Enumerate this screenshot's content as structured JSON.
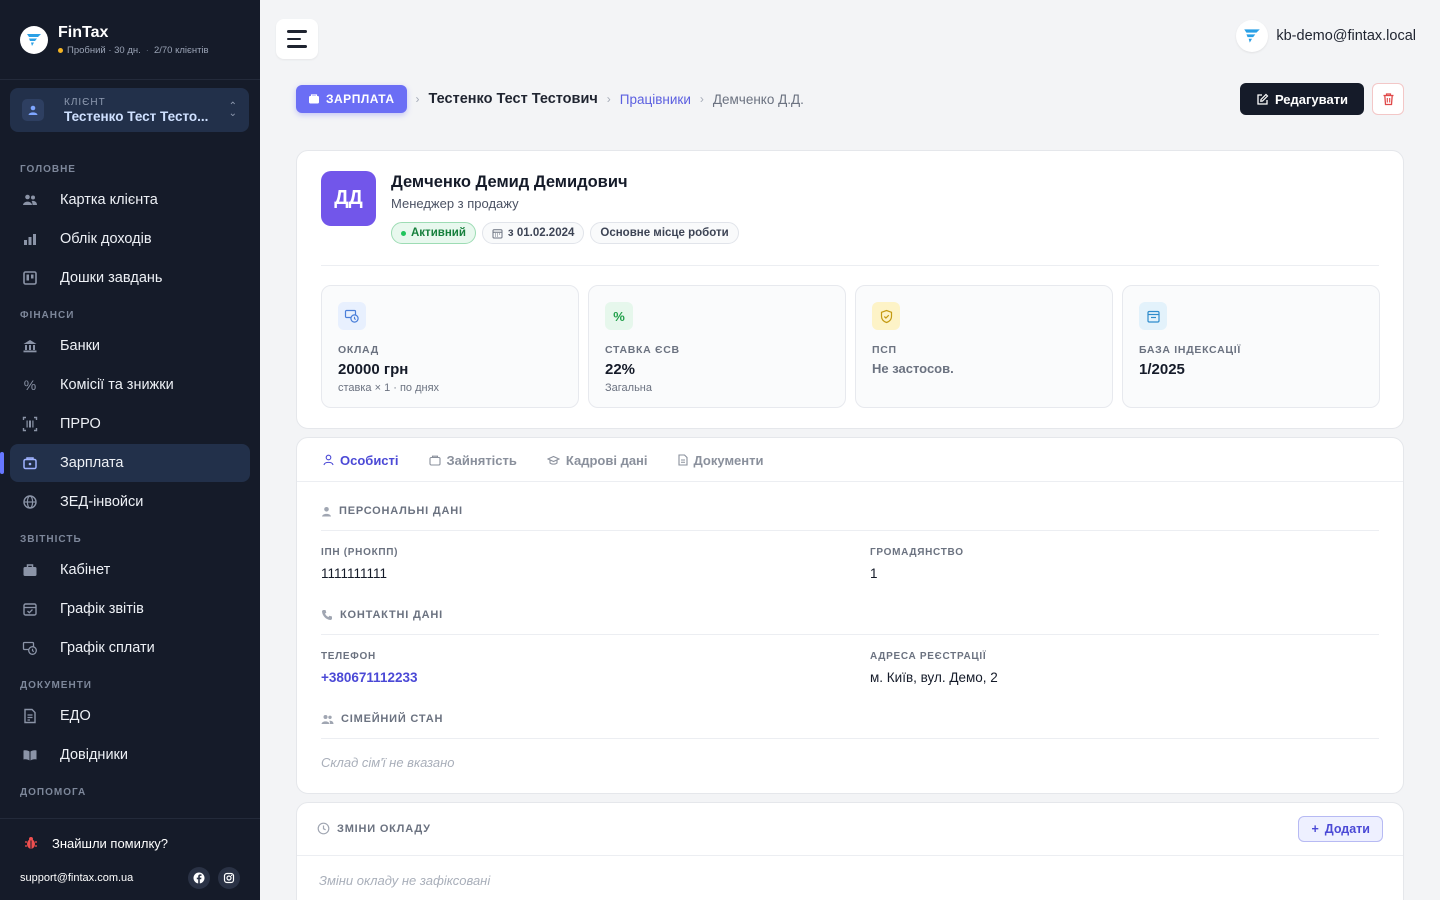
{
  "brand": {
    "name": "FinTax",
    "trial": "Пробний · 30 дн.",
    "clients": "2/70 клієнтів"
  },
  "client": {
    "label": "КЛІЄНТ",
    "name": "Тестенко Тест Тесто..."
  },
  "nav": {
    "sections": {
      "main": "ГОЛОВНЕ",
      "finance": "ФІНАНСИ",
      "reports": "ЗВІТНІСТЬ",
      "docs": "ДОКУМЕНТИ",
      "help": "ДОПОМОГА"
    },
    "items": {
      "client_card": "Картка клієнта",
      "income": "Облік доходів",
      "tasks": "Дошки завдань",
      "banks": "Банки",
      "commissions": "Комісії та знижки",
      "prro": "ПРРО",
      "salary": "Зарплата",
      "zed": "ЗЕД-інвойси",
      "cabinet": "Кабінет",
      "report_schedule": "Графік звітів",
      "payment_schedule": "Графік сплати",
      "edo": "ЕДО",
      "directories": "Довідники"
    }
  },
  "footer": {
    "bug": "Знайшли помилку?",
    "support": "support@fintax.com.ua"
  },
  "user": {
    "email": "kb-demo@fintax.local"
  },
  "breadcrumb": {
    "section": "ЗАРПЛАТА",
    "client": "Тестенко Тест Тестович",
    "employees": "Працівники",
    "current": "Демченко Д.Д."
  },
  "actions": {
    "edit": "Редагувати"
  },
  "employee": {
    "initials": "ДД",
    "name": "Демченко Демид Демидович",
    "role": "Менеджер з продажу",
    "status": "Активний",
    "since": "з 01.02.2024",
    "workplace": "Основне місце роботи"
  },
  "stats": {
    "salary": {
      "label": "ОКЛАД",
      "value": "20000 грн",
      "sub": "ставка × 1 · по днях"
    },
    "esv": {
      "label": "СТАВКА ЄСВ",
      "value": "22%",
      "sub": "Загальна"
    },
    "psp": {
      "label": "ПСП",
      "value": "Не застосов."
    },
    "index": {
      "label": "БАЗА ІНДЕКСАЦІЇ",
      "value": "1/2025"
    }
  },
  "tabs": {
    "personal": "Особисті",
    "employment": "Зайнятість",
    "hr": "Кадрові дані",
    "documents": "Документи"
  },
  "personal": {
    "title": "ПЕРСОНАЛЬНІ ДАНІ",
    "ipn_label": "ІПН (РНОКПП)",
    "ipn": "1111111111",
    "citizenship_label": "ГРОМАДЯНСТВО",
    "citizenship": "1"
  },
  "contacts": {
    "title": "КОНТАКТНІ ДАНІ",
    "phone_label": "ТЕЛЕФОН",
    "phone": "+380671112233",
    "address_label": "АДРЕСА РЕЄСТРАЦІЇ",
    "address": "м. Київ, вул. Демо, 2"
  },
  "family": {
    "title": "СІМЕЙНИЙ СТАН",
    "empty": "Склад сім'ї не вказано"
  },
  "salary_changes": {
    "title": "ЗМІНИ ОКЛАДУ",
    "add": "Додати",
    "empty": "Зміни окладу не зафіксовані"
  },
  "colors": {
    "sidebar": "#151b29",
    "accent": "#6b6ef5",
    "avatar": "#7256ea",
    "active_green": "#17803d"
  }
}
